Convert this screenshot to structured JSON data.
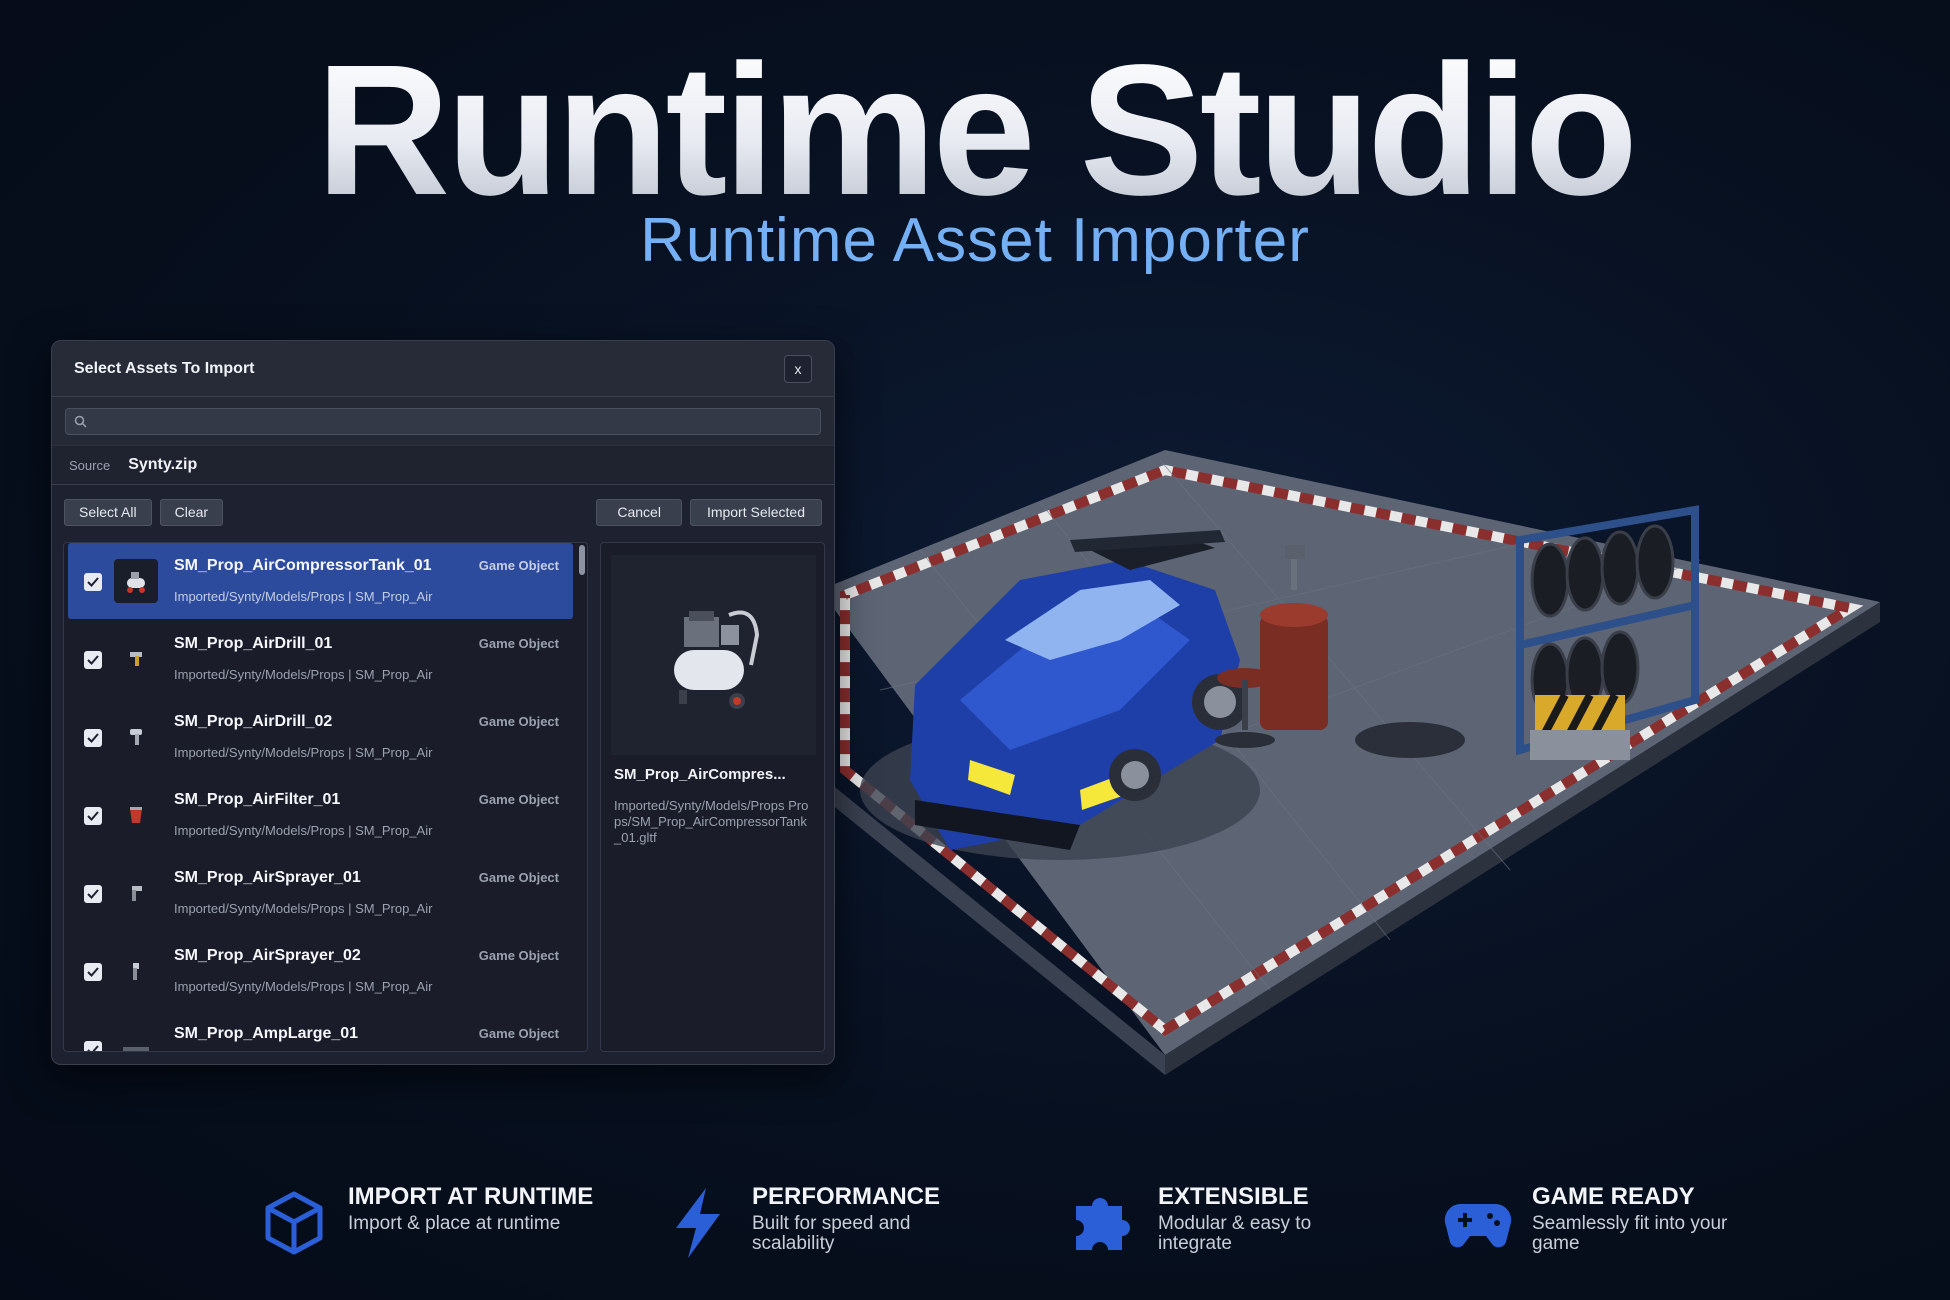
{
  "hero": {
    "title": "Runtime Studio",
    "subtitle": "Runtime Asset Importer"
  },
  "dialog": {
    "title": "Select Assets To Import",
    "close_label": "x",
    "search": {
      "value": "",
      "placeholder": ""
    },
    "source_label": "Source",
    "source_value": "Synty.zip",
    "buttons": {
      "select_all": "Select All",
      "clear": "Clear",
      "cancel": "Cancel",
      "import_selected": "Import Selected"
    },
    "items": [
      {
        "name": "SM_Prop_AirCompressorTank_01",
        "type": "Game Object",
        "path": "Imported/Synty/Models/Props | SM_Prop_Air",
        "checked": true,
        "selected": true,
        "icon": "air-compressor-icon"
      },
      {
        "name": "SM_Prop_AirDrill_01",
        "type": "Game Object",
        "path": "Imported/Synty/Models/Props | SM_Prop_Air",
        "checked": true,
        "selected": false,
        "icon": "air-drill-icon"
      },
      {
        "name": "SM_Prop_AirDrill_02",
        "type": "Game Object",
        "path": "Imported/Synty/Models/Props | SM_Prop_Air",
        "checked": true,
        "selected": false,
        "icon": "air-drill-icon"
      },
      {
        "name": "SM_Prop_AirFilter_01",
        "type": "Game Object",
        "path": "Imported/Synty/Models/Props | SM_Prop_Air",
        "checked": true,
        "selected": false,
        "icon": "air-filter-icon"
      },
      {
        "name": "SM_Prop_AirSprayer_01",
        "type": "Game Object",
        "path": "Imported/Synty/Models/Props | SM_Prop_Air",
        "checked": true,
        "selected": false,
        "icon": "air-sprayer-icon"
      },
      {
        "name": "SM_Prop_AirSprayer_02",
        "type": "Game Object",
        "path": "Imported/Synty/Models/Props | SM_Prop_Air",
        "checked": true,
        "selected": false,
        "icon": "air-sprayer-icon"
      },
      {
        "name": "SM_Prop_AmpLarge_01",
        "type": "Game Object",
        "path": "",
        "checked": true,
        "selected": false,
        "icon": "amp-icon"
      }
    ],
    "preview": {
      "name": "SM_Prop_AirCompres...",
      "path": "Imported/Synty/Models/Props Props/SM_Prop_AirCompressorTank_01.gltf"
    }
  },
  "features": [
    {
      "title": "IMPORT AT RUNTIME",
      "desc": "Import & place at runtime",
      "icon": "cube-icon"
    },
    {
      "title": "PERFORMANCE",
      "desc": "Built for speed and scalability",
      "icon": "lightning-icon"
    },
    {
      "title": "EXTENSIBLE",
      "desc": "Modular & easy to integrate",
      "icon": "puzzle-icon"
    },
    {
      "title": "GAME READY",
      "desc": "Seamlessly fit into your game",
      "icon": "gamepad-icon"
    }
  ],
  "colors": {
    "accent": "#2c4b9c",
    "subtitle": "#75b0f5",
    "icon_blue": "#2b5fd8"
  }
}
